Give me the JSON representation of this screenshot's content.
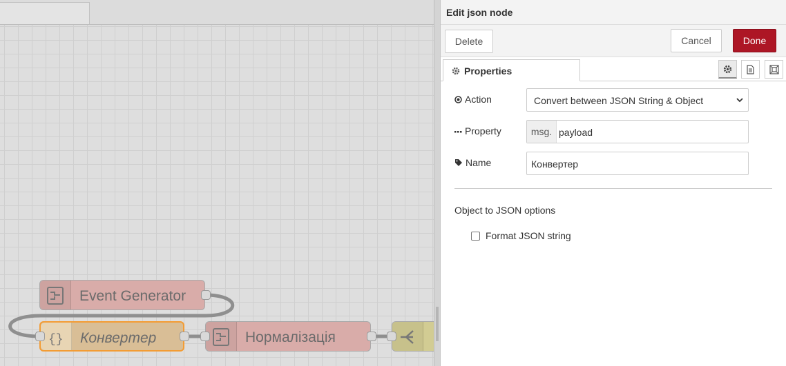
{
  "workspace": {
    "tab_label": "",
    "nodes": [
      {
        "label": "Event Generator",
        "color": "#e3b3b0"
      },
      {
        "label": "Конвертер",
        "color": "#e0c59d",
        "selected_border": "#f39c34"
      },
      {
        "label": "Нормалізація",
        "color": "#e3b3b0"
      },
      {
        "label": "",
        "color": "#d8d29b"
      }
    ]
  },
  "editor": {
    "title": "Edit json node",
    "delete_label": "Delete",
    "cancel_label": "Cancel",
    "done_label": "Done",
    "done_color": "#ad1625",
    "tab_properties": "Properties",
    "action_label": "Action",
    "action_value": "Convert between JSON String & Object",
    "property_label": "Property",
    "property_prefix": "msg.",
    "property_value": "payload",
    "name_label": "Name",
    "name_value": "Конвертер",
    "object_options_heading": "Object to JSON options",
    "format_label": "Format JSON string",
    "format_checked": false
  }
}
